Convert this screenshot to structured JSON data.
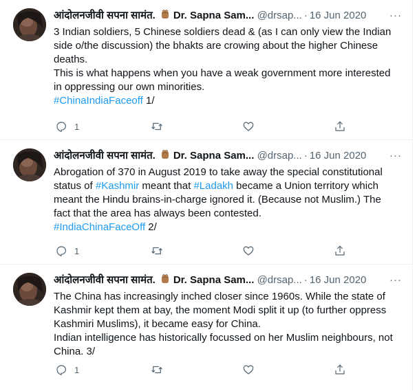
{
  "colors": {
    "link": "#1d9bf0",
    "muted": "#536471",
    "text": "#0f1419"
  },
  "tweets": [
    {
      "name": "आंदोलनजीवी सपना सामंत.",
      "name_suffix": "Dr. Sapna Sam...",
      "handle": "@drsap...",
      "date": "16 Jun 2020",
      "more": "···",
      "lines": [
        "3 Indian soldiers, 5 Chinese soldiers dead & (as I can only view the Indian side o/the discussion) the bhakts are crowing about the higher Chinese deaths.",
        "This is what happens when you have a weak government more interested in oppressing our own minorities."
      ],
      "hashtag": "#ChinaIndiaFaceoff",
      "tail": " 1/",
      "reply_count": "1"
    },
    {
      "name": "आंदोलनजीवी सपना सामंत.",
      "name_suffix": "Dr. Sapna Sam...",
      "handle": "@drsap...",
      "date": "16 Jun 2020",
      "more": "···",
      "seg1": "Abrogation of 370 in August 2019 to take away the special constitutional status of ",
      "tag1": "#Kashmir",
      "seg2": " meant that ",
      "tag2": "#Ladakh",
      "seg3": " became a Union territory which meant the Hindu brains-in-charge ignored it. (Because not Muslim.) The fact that the area has always been contested.",
      "hashtag": "#IndiaChinaFaceOff",
      "tail": " 2/",
      "reply_count": "1"
    },
    {
      "name": "आंदोलनजीवी सपना सामंत.",
      "name_suffix": "Dr. Sapna Sam...",
      "handle": "@drsap...",
      "date": "16 Jun 2020",
      "more": "···",
      "lines": [
        "The China has increasingly inched closer since 1960s. While the state of Kashmir kept them at bay, the moment Modi split it up (to further oppress Kashmiri Muslims), it became easy for China.",
        "Indian intelligence has historically focussed on her Muslim neighbours, not China. 3/"
      ],
      "reply_count": "1"
    }
  ]
}
